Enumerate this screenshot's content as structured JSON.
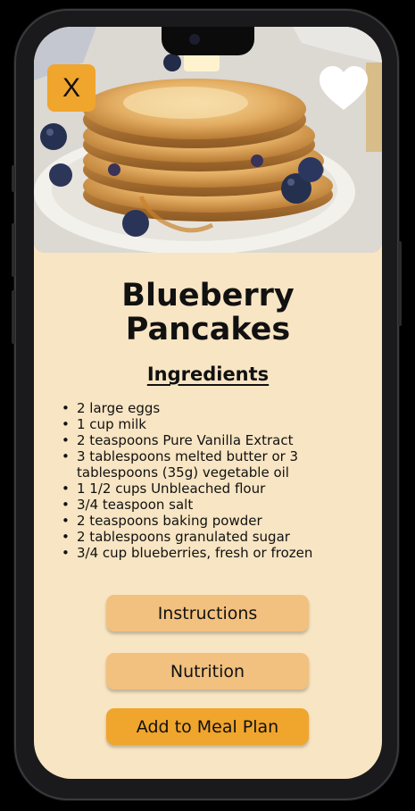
{
  "recipe": {
    "title_line1": "Blueberry",
    "title_line2": "Pancakes"
  },
  "header": {
    "close_label": "X"
  },
  "ingredients": {
    "heading": "Ingredients",
    "items": [
      "2 large eggs",
      "1 cup milk",
      "2 teaspoons Pure Vanilla Extract",
      "3 tablespoons melted butter or 3 tablespoons (35g) vegetable oil",
      "1 1/2 cups Unbleached flour",
      "3/4 teaspoon salt",
      "2 teaspoons baking powder",
      "2 tablespoons granulated sugar",
      "3/4 cup blueberries, fresh or frozen"
    ]
  },
  "actions": {
    "instructions_label": "Instructions",
    "nutrition_label": "Nutrition",
    "meal_plan_label": "Add to Meal Plan"
  },
  "colors": {
    "background": "#f8e5c3",
    "accent": "#f0a52c",
    "button_light": "#f2c17f"
  },
  "icons": {
    "favorite": "heart-icon",
    "close": "close-icon"
  }
}
